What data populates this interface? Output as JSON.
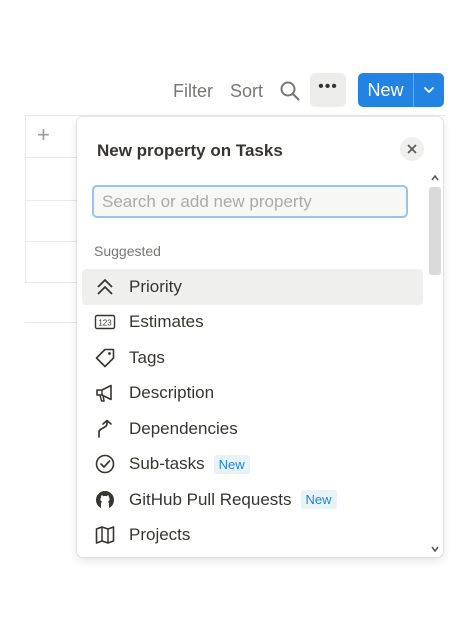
{
  "toolbar": {
    "filter_label": "Filter",
    "sort_label": "Sort",
    "search_icon": "search-icon",
    "more_icon": "more-horizontal-icon",
    "new_label": "New",
    "new_dropdown_icon": "chevron-down-icon",
    "accent": "#2383e2"
  },
  "table": {
    "add_column_icon": "plus-icon"
  },
  "popup": {
    "title": "New property on Tasks",
    "close_icon": "close-icon",
    "search": {
      "placeholder": "Search or add new property",
      "value": ""
    },
    "section_label": "Suggested",
    "items": [
      {
        "label": "Priority",
        "icon": "double-chevron-up-icon",
        "highlighted": true,
        "badge": ""
      },
      {
        "label": "Estimates",
        "icon": "number-123-icon",
        "highlighted": false,
        "badge": ""
      },
      {
        "label": "Tags",
        "icon": "tag-icon",
        "highlighted": false,
        "badge": ""
      },
      {
        "label": "Description",
        "icon": "megaphone-icon",
        "highlighted": false,
        "badge": ""
      },
      {
        "label": "Dependencies",
        "icon": "dependency-arrow-icon",
        "highlighted": false,
        "badge": ""
      },
      {
        "label": "Sub-tasks",
        "icon": "check-circle-icon",
        "highlighted": false,
        "badge": "New"
      },
      {
        "label": "GitHub Pull Requests",
        "icon": "github-icon",
        "highlighted": false,
        "badge": "New"
      },
      {
        "label": "Projects",
        "icon": "map-icon",
        "highlighted": false,
        "badge": ""
      }
    ]
  }
}
